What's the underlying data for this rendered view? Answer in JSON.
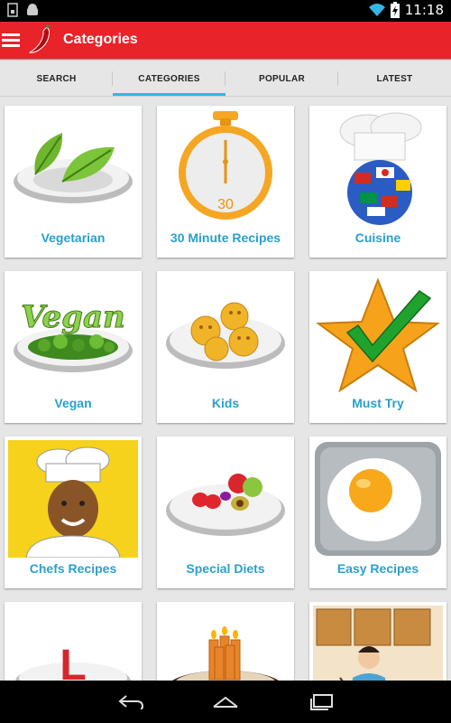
{
  "status_bar": {
    "time": "11:18"
  },
  "app_bar": {
    "title": "Categories"
  },
  "tabs": [
    {
      "label": "SEARCH",
      "active": false
    },
    {
      "label": "CATEGORIES",
      "active": true
    },
    {
      "label": "POPULAR",
      "active": false
    },
    {
      "label": "LATEST",
      "active": false
    }
  ],
  "categories": [
    {
      "label": "Vegetarian",
      "icon": "leaves-on-plate-icon"
    },
    {
      "label": "30 Minute Recipes",
      "icon": "stopwatch-icon",
      "stopwatch_number": "30"
    },
    {
      "label": "Cuisine",
      "icon": "chef-hat-globe-icon"
    },
    {
      "label": "Vegan",
      "icon": "vegan-plate-icon",
      "plate_text": "Vegan"
    },
    {
      "label": "Kids",
      "icon": "smiley-cookies-icon"
    },
    {
      "label": "Must Try",
      "icon": "star-checkmark-icon"
    },
    {
      "label": "Chefs Recipes",
      "icon": "chef-portrait-icon"
    },
    {
      "label": "Special Diets",
      "icon": "fruit-plate-icon"
    },
    {
      "label": "Easy Recipes",
      "icon": "fried-egg-icon"
    },
    {
      "label": "",
      "icon": "letter-l-plate-icon",
      "plate_text": "L"
    },
    {
      "label": "",
      "icon": "birthday-candles-icon"
    },
    {
      "label": "",
      "icon": "man-cooking-kitchen-icon"
    }
  ],
  "colors": {
    "app_bar": "#e8232a",
    "tab_indicator": "#33b5e5",
    "card_label": "#2aa0cb"
  }
}
